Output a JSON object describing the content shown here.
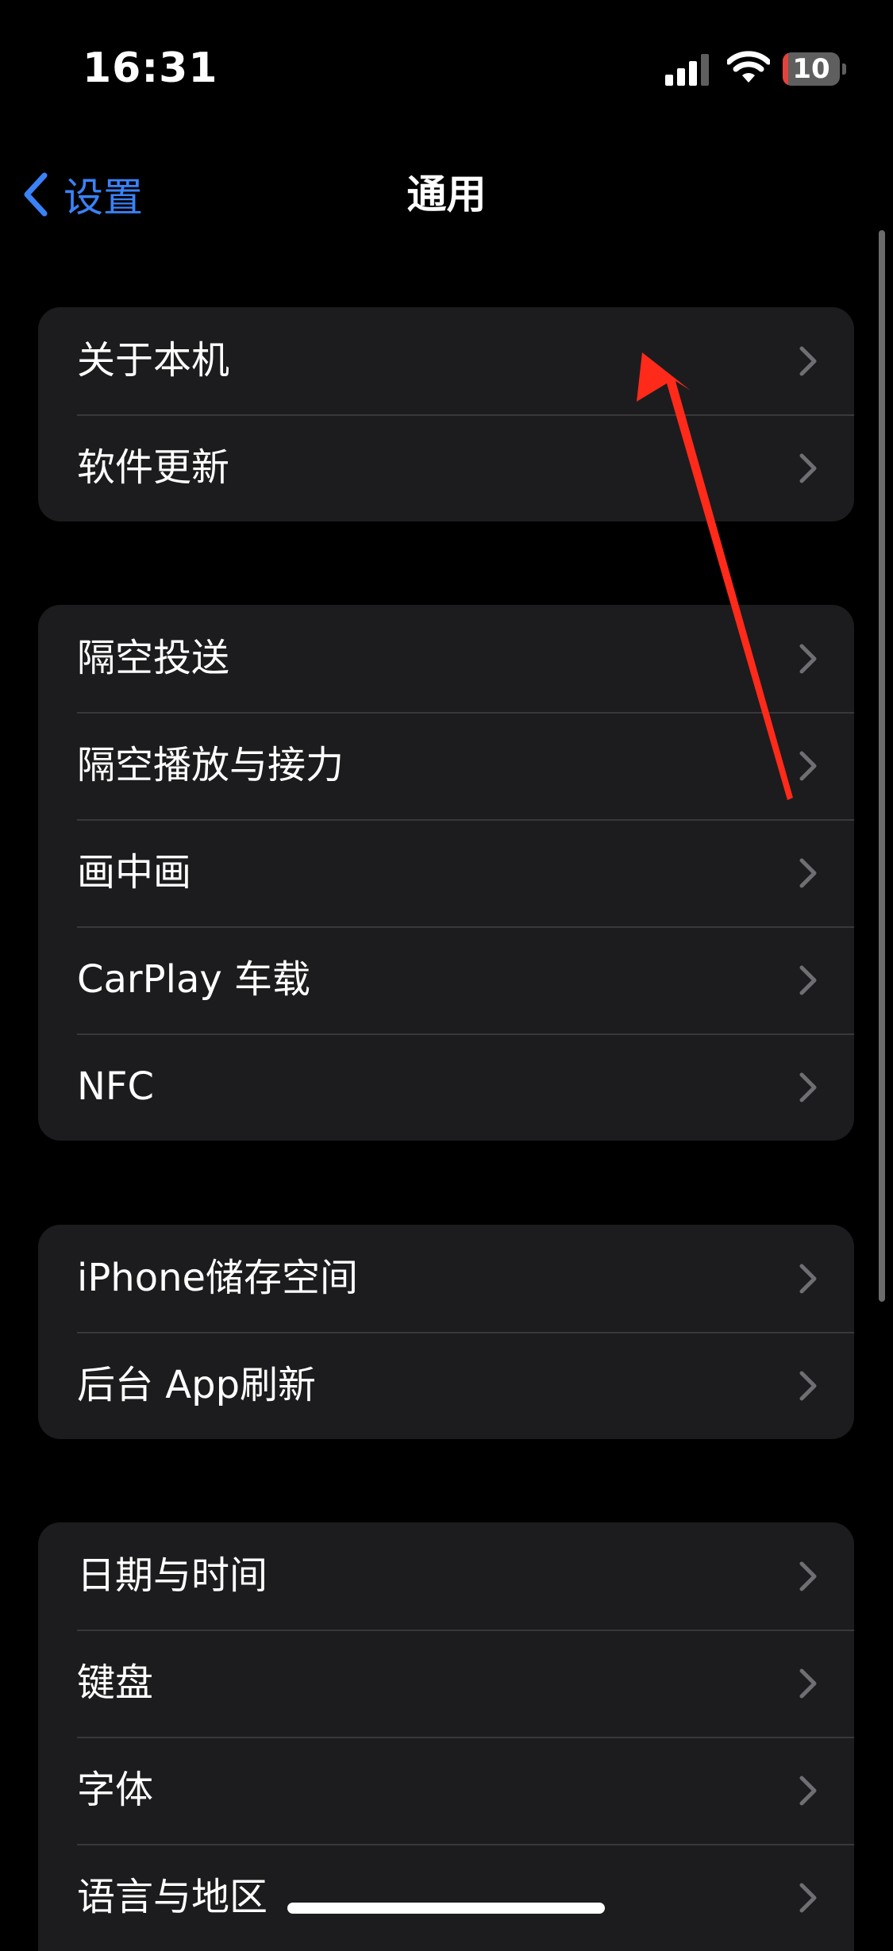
{
  "status_bar": {
    "time": "16:31",
    "battery_level": "10",
    "battery_fraction": 0.1,
    "battery_color": "#e2443d"
  },
  "nav": {
    "back_label": "设置",
    "title": "通用",
    "accent_color": "#3a82f7"
  },
  "groups": [
    {
      "items": [
        {
          "label": "关于本机"
        },
        {
          "label": "软件更新"
        }
      ]
    },
    {
      "items": [
        {
          "label": "隔空投送"
        },
        {
          "label": "隔空播放与接力"
        },
        {
          "label": "画中画"
        },
        {
          "label": "CarPlay 车载"
        },
        {
          "label": "NFC"
        }
      ]
    },
    {
      "items": [
        {
          "label": "iPhone储存空间"
        },
        {
          "label": "后台 App刷新"
        }
      ]
    },
    {
      "items": [
        {
          "label": "日期与时间"
        },
        {
          "label": "键盘"
        },
        {
          "label": "字体"
        },
        {
          "label": "语言与地区"
        }
      ]
    }
  ],
  "annotation": {
    "arrow_color": "#ff2a1a",
    "icon": "red-arrow-pointing-to-about"
  }
}
